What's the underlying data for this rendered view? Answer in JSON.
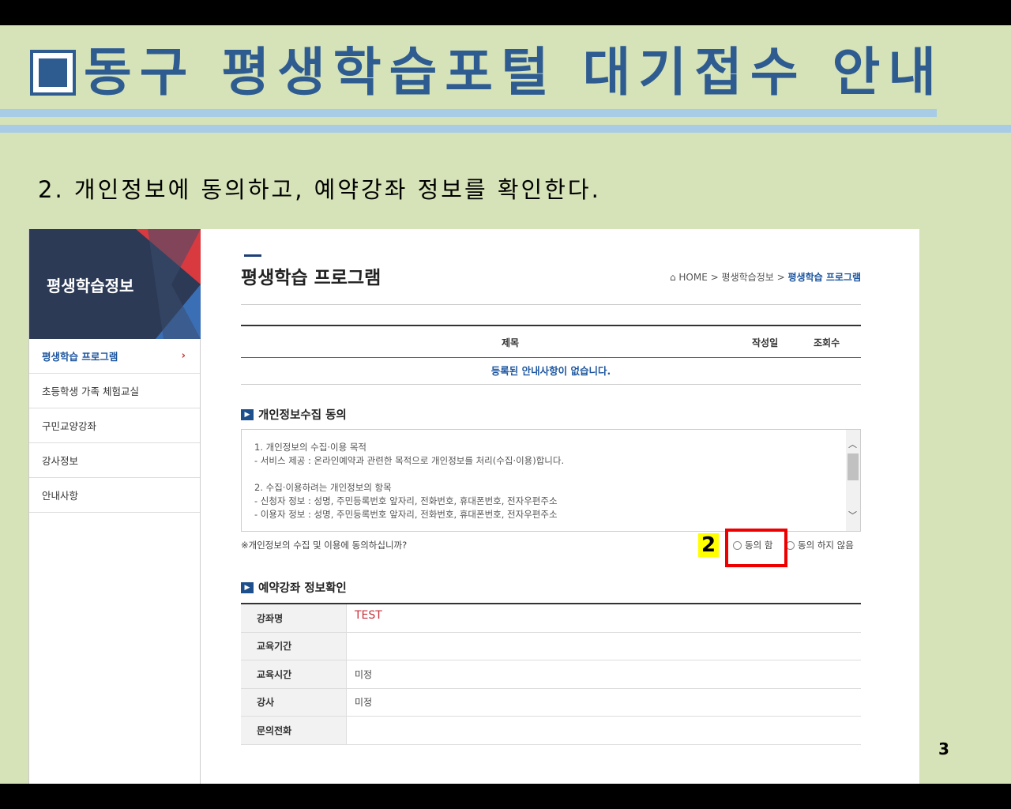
{
  "slide": {
    "title": "동구 평생학습포털 대기접수 안내",
    "step_text": "2. 개인정보에 동의하고, 예약강좌 정보를 확인한다.",
    "page_number": "3",
    "step_badge": "2",
    "colors": {
      "background": "#d6e2b7",
      "title": "#2e5c91",
      "highlight_box": "#ee0000",
      "badge": "#ffff00"
    }
  },
  "sidebar": {
    "title": "평생학습정보",
    "items": [
      {
        "label": "평생학습 프로그램",
        "active": true,
        "chevron": "›"
      },
      {
        "label": "초등학생 가족 체험교실"
      },
      {
        "label": "구민교양강좌"
      },
      {
        "label": "강사정보"
      },
      {
        "label": "안내사항"
      }
    ]
  },
  "main": {
    "page_title": "평생학습 프로그램",
    "breadcrumb": {
      "home": "HOME",
      "sep": ">",
      "level1": "평생학습정보",
      "current": "평생학습 프로그램"
    },
    "notice_table": {
      "columns": [
        "제목",
        "작성일",
        "조회수"
      ],
      "empty_message": "등록된 안내사항이 없습니다."
    },
    "privacy": {
      "section_title": "개인정보수집 동의",
      "terms_lines": [
        "1. 개인정보의 수집·이용 목적",
        "- 서비스 제공 : 온라인예약과 관련한 목적으로 개인정보를 처리(수집·이용)합니다.",
        "",
        "2. 수집·이용하려는 개인정보의 항목",
        "- 신청자 정보 : 성명, 주민등록번호 앞자리, 전화번호, 휴대폰번호, 전자우편주소",
        "- 이용자 정보 : 성명, 주민등록번호 앞자리, 전화번호, 휴대폰번호, 전자우편주소"
      ],
      "question": "※개인정보의 수집 및 이용에 동의하십니까?",
      "agree_label": "동의 함",
      "disagree_label": "동의 하지 않음"
    },
    "course": {
      "section_title": "예약강좌 정보확인",
      "rows": [
        {
          "label": "강좌명",
          "value": "TEST"
        },
        {
          "label": "교육기간",
          "value": ""
        },
        {
          "label": "교육시간",
          "value": "미정"
        },
        {
          "label": "강사",
          "value": "미정"
        },
        {
          "label": "문의전화",
          "value": ""
        }
      ]
    }
  }
}
